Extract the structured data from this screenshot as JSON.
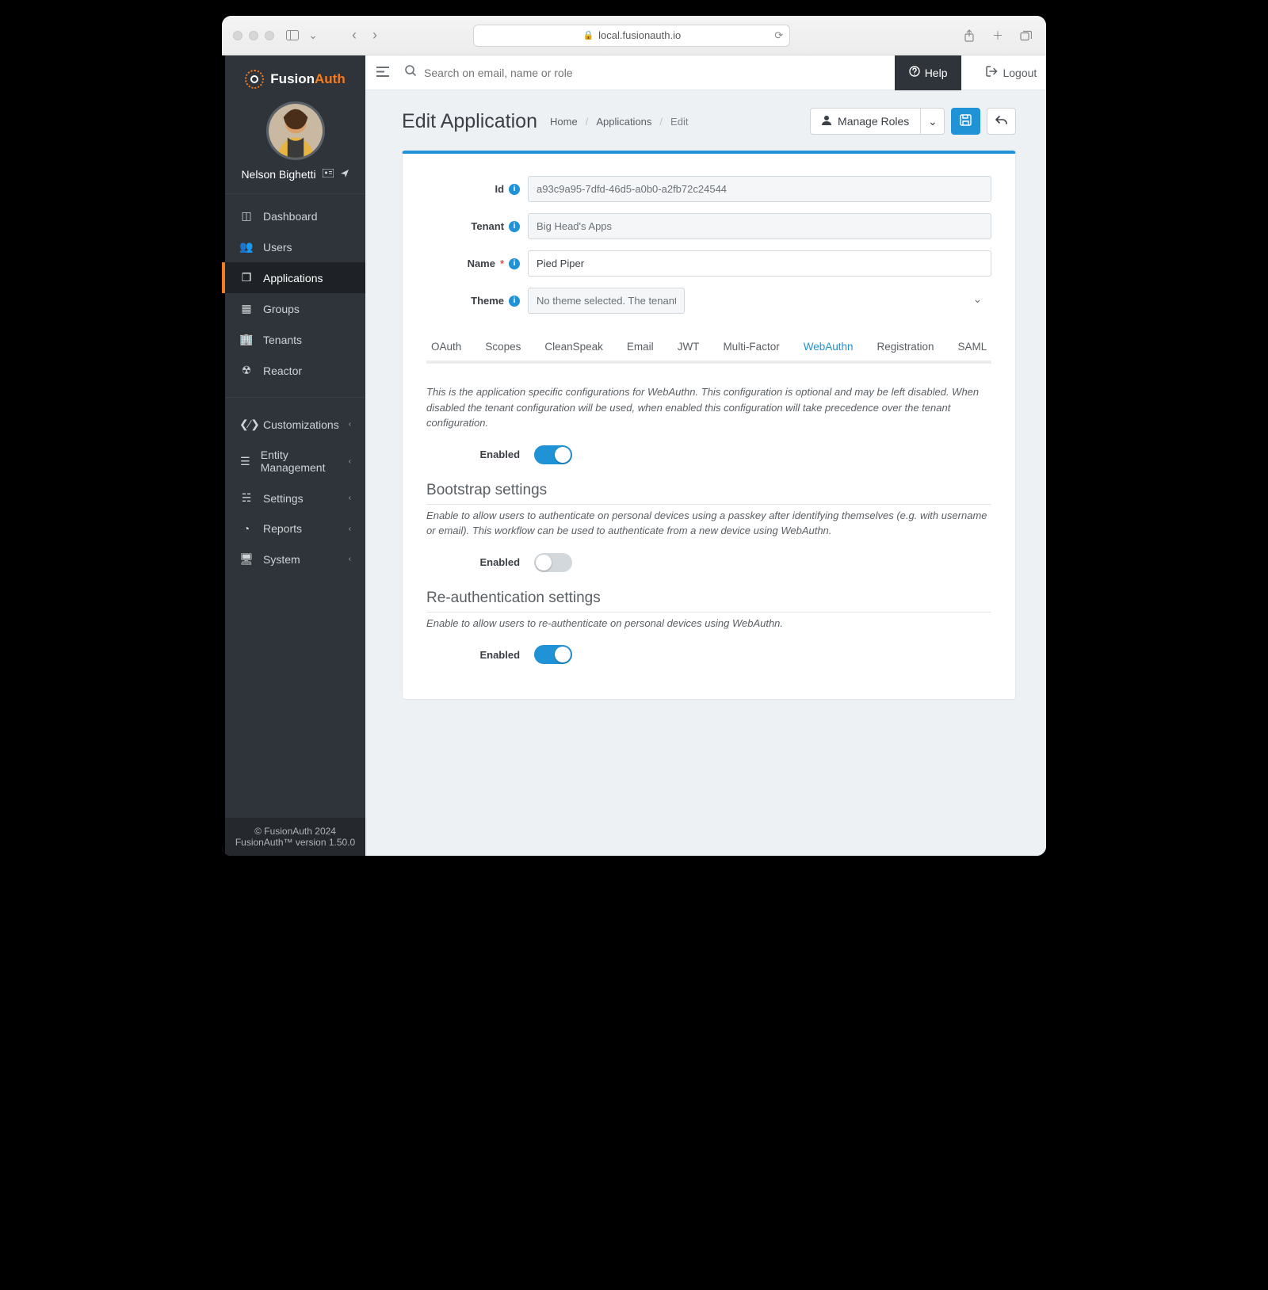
{
  "browser": {
    "url_host": "local.fusionauth.io"
  },
  "logo": {
    "brand_a": "Fusion",
    "brand_b": "Auth"
  },
  "profile": {
    "name": "Nelson Bighetti"
  },
  "sidebar": {
    "items": [
      {
        "label": "Dashboard"
      },
      {
        "label": "Users"
      },
      {
        "label": "Applications"
      },
      {
        "label": "Groups"
      },
      {
        "label": "Tenants"
      },
      {
        "label": "Reactor"
      },
      {
        "label": "Customizations"
      },
      {
        "label": "Entity Management"
      },
      {
        "label": "Settings"
      },
      {
        "label": "Reports"
      },
      {
        "label": "System"
      }
    ],
    "footer_a": "© FusionAuth 2024",
    "footer_b": "FusionAuth™ version 1.50.0"
  },
  "topbar": {
    "search_placeholder": "Search on email, name or role",
    "help": "Help",
    "logout": "Logout"
  },
  "header": {
    "title": "Edit Application",
    "crumbs": [
      "Home",
      "Applications",
      "Edit"
    ],
    "manage_roles": "Manage Roles"
  },
  "form": {
    "id_label": "Id",
    "id_value": "a93c9a95-7dfd-46d5-a0b0-a2fb72c24544",
    "tenant_label": "Tenant",
    "tenant_value": "Big Head's Apps",
    "name_label": "Name",
    "name_value": "Pied Piper",
    "theme_label": "Theme",
    "theme_value": "No theme selected. The tenant configuration will be used."
  },
  "tabs": [
    "OAuth",
    "Scopes",
    "CleanSpeak",
    "Email",
    "JWT",
    "Multi-Factor",
    "WebAuthn",
    "Registration",
    "SAML"
  ],
  "active_tab": "WebAuthn",
  "webauthn": {
    "intro": "This is the application specific configurations for WebAuthn. This configuration is optional and may be left disabled. When disabled the tenant configuration will be used, when enabled this configuration will take precedence over the tenant configuration.",
    "enabled_label": "Enabled",
    "enabled": true,
    "bootstrap_heading": "Bootstrap settings",
    "bootstrap_desc": "Enable to allow users to authenticate on personal devices using a passkey after identifying themselves (e.g. with username or email). This workflow can be used to authenticate from a new device using WebAuthn.",
    "bootstrap_enabled": false,
    "reauth_heading": "Re-authentication settings",
    "reauth_desc": "Enable to allow users to re-authenticate on personal devices using WebAuthn.",
    "reauth_enabled": true
  }
}
